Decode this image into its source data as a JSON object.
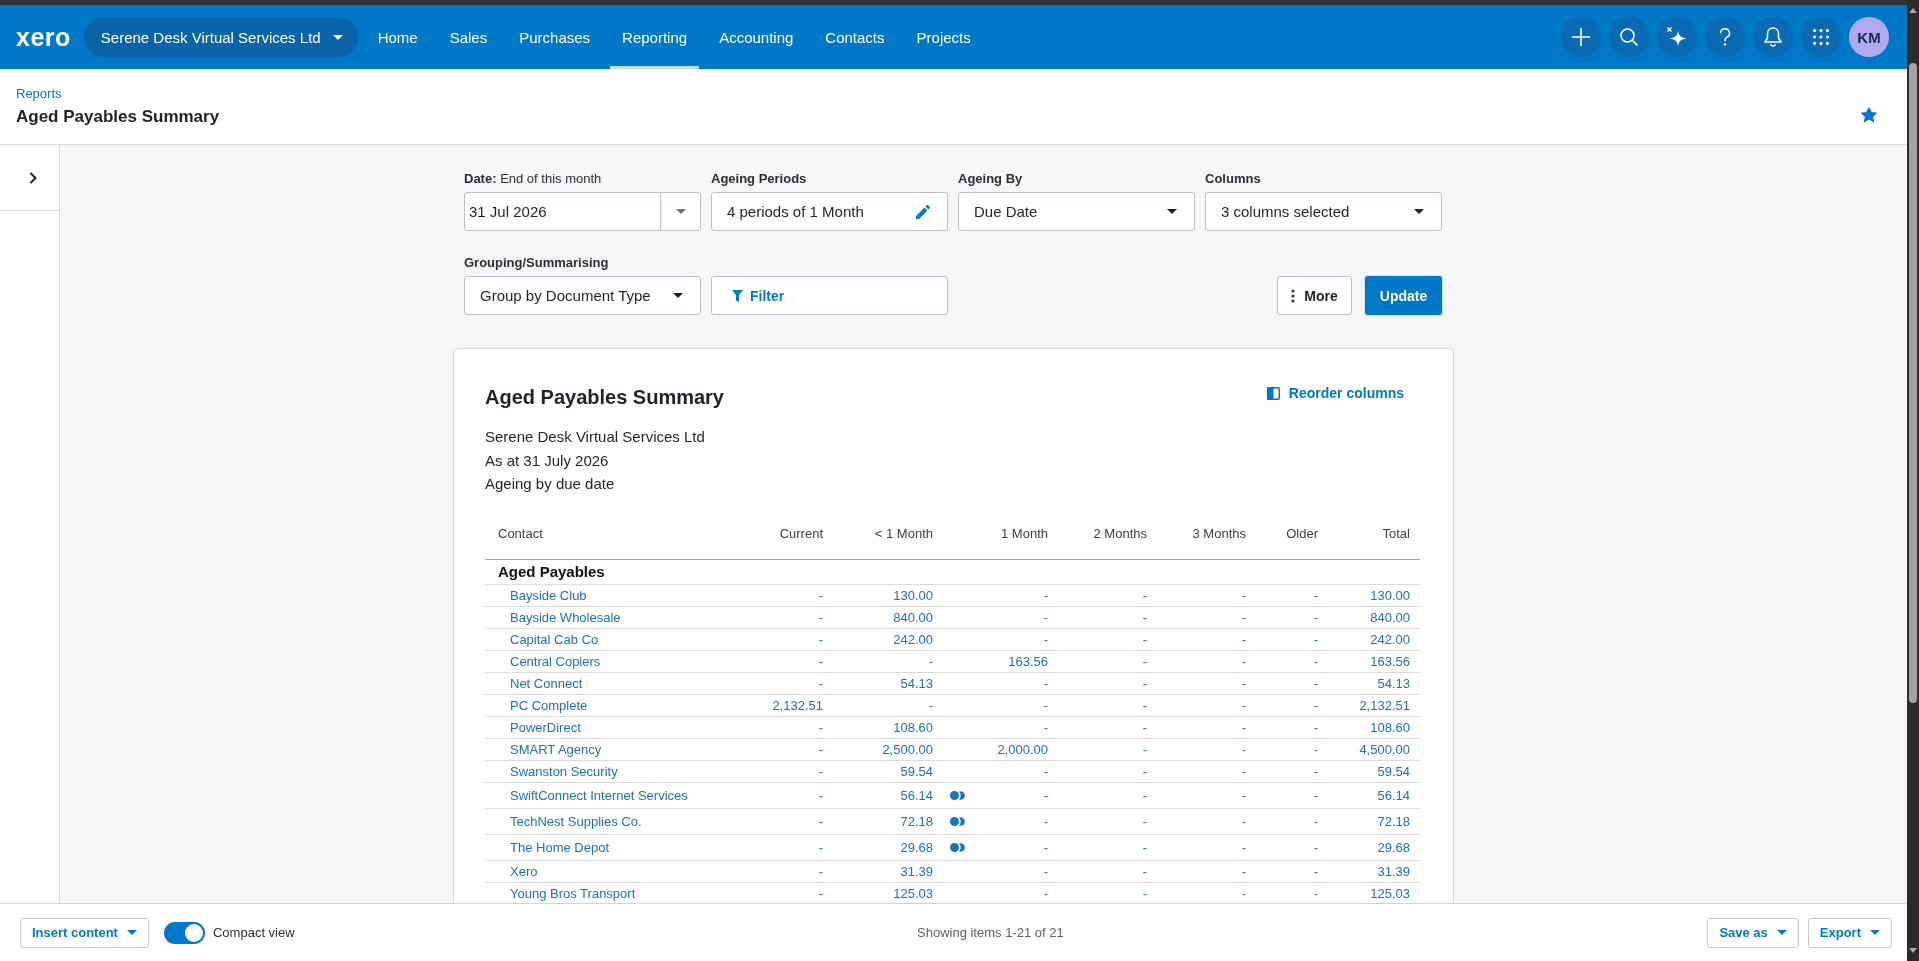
{
  "topbar": {
    "logo": "xero",
    "organisation": "Serene Desk Virtual Services Ltd",
    "nav": [
      {
        "label": "Home",
        "selected": false
      },
      {
        "label": "Sales",
        "selected": false
      },
      {
        "label": "Purchases",
        "selected": false
      },
      {
        "label": "Reporting",
        "selected": true
      },
      {
        "label": "Accounting",
        "selected": false
      },
      {
        "label": "Contacts",
        "selected": false
      },
      {
        "label": "Projects",
        "selected": false
      }
    ],
    "avatar": "KM"
  },
  "header": {
    "breadcrumb": "Reports",
    "title": "Aged Payables Summary",
    "favourite": true
  },
  "side_panel": {
    "expanded": false
  },
  "filters": {
    "fields": [
      {
        "kind": "date",
        "label": "**Date:** End of this month",
        "value": "31 Jul 2026"
      },
      {
        "kind": "edit",
        "label": "Ageing Periods",
        "value": "4 periods of 1 Month"
      },
      {
        "kind": "select",
        "label": "Ageing By",
        "value": "Due Date"
      },
      {
        "kind": "select",
        "label": "Columns",
        "value": "3 columns selected"
      },
      {
        "kind": "select",
        "label": "Grouping/Summarising",
        "value": "Group by Document Type"
      }
    ],
    "filter_button": "Filter",
    "more_button": "More",
    "update_button": "Update"
  },
  "report": {
    "title": "Aged Payables Summary",
    "reorder_button": "Reorder columns",
    "details": [
      "Serene Desk Virtual Services Ltd",
      "As at 31 July 2026",
      "Ageing by due date"
    ],
    "columns": [
      "Contact",
      "Current",
      "< 1 Month",
      "1 Month",
      "2 Months",
      "3 Months",
      "Older",
      "Total"
    ],
    "section": "Aged Payables",
    "rows": [
      {
        "contact": "Bayside Club",
        "values": [
          "-",
          "130.00",
          "-",
          "-",
          "-",
          "-",
          "130.00"
        ],
        "indicator": false
      },
      {
        "contact": "Bayside Wholesale",
        "values": [
          "-",
          "840.00",
          "-",
          "-",
          "-",
          "-",
          "840.00"
        ],
        "indicator": false
      },
      {
        "contact": "Capital Cab Co",
        "values": [
          "-",
          "242.00",
          "-",
          "-",
          "-",
          "-",
          "242.00"
        ],
        "indicator": false
      },
      {
        "contact": "Central Copiers",
        "values": [
          "-",
          "-",
          "163.56",
          "-",
          "-",
          "-",
          "163.56"
        ],
        "indicator": false
      },
      {
        "contact": "Net Connect",
        "values": [
          "-",
          "54.13",
          "-",
          "-",
          "-",
          "-",
          "54.13"
        ],
        "indicator": false
      },
      {
        "contact": "PC Complete",
        "values": [
          "2,132.51",
          "-",
          "-",
          "-",
          "-",
          "-",
          "2,132.51"
        ],
        "indicator": false
      },
      {
        "contact": "PowerDirect",
        "values": [
          "-",
          "108.60",
          "-",
          "-",
          "-",
          "-",
          "108.60"
        ],
        "indicator": false
      },
      {
        "contact": "SMART Agency",
        "values": [
          "-",
          "2,500.00",
          "2,000.00",
          "-",
          "-",
          "-",
          "4,500.00"
        ],
        "indicator": false
      },
      {
        "contact": "Swanston Security",
        "values": [
          "-",
          "59.54",
          "-",
          "-",
          "-",
          "-",
          "59.54"
        ],
        "indicator": false
      },
      {
        "contact": "SwiftConnect Internet Services",
        "values": [
          "-",
          "56.14",
          "-",
          "-",
          "-",
          "-",
          "56.14"
        ],
        "indicator": true
      },
      {
        "contact": "TechNest Supplies Co.",
        "values": [
          "-",
          "72.18",
          "-",
          "-",
          "-",
          "-",
          "72.18"
        ],
        "indicator": true
      },
      {
        "contact": "The Home Depot",
        "values": [
          "-",
          "29.68",
          "-",
          "-",
          "-",
          "-",
          "29.68"
        ],
        "indicator": true
      },
      {
        "contact": "Xero",
        "values": [
          "-",
          "31.39",
          "-",
          "-",
          "-",
          "-",
          "31.39"
        ],
        "indicator": false
      },
      {
        "contact": "Young Bros Transport",
        "values": [
          "-",
          "125.03",
          "-",
          "-",
          "-",
          "-",
          "125.03"
        ],
        "indicator": false
      }
    ]
  },
  "footer": {
    "insert_button": "Insert content",
    "compact_view": {
      "label": "Compact view",
      "on": true
    },
    "status": "Showing items 1-21 of 21",
    "save_button": "Save as",
    "export_button": "Export"
  }
}
